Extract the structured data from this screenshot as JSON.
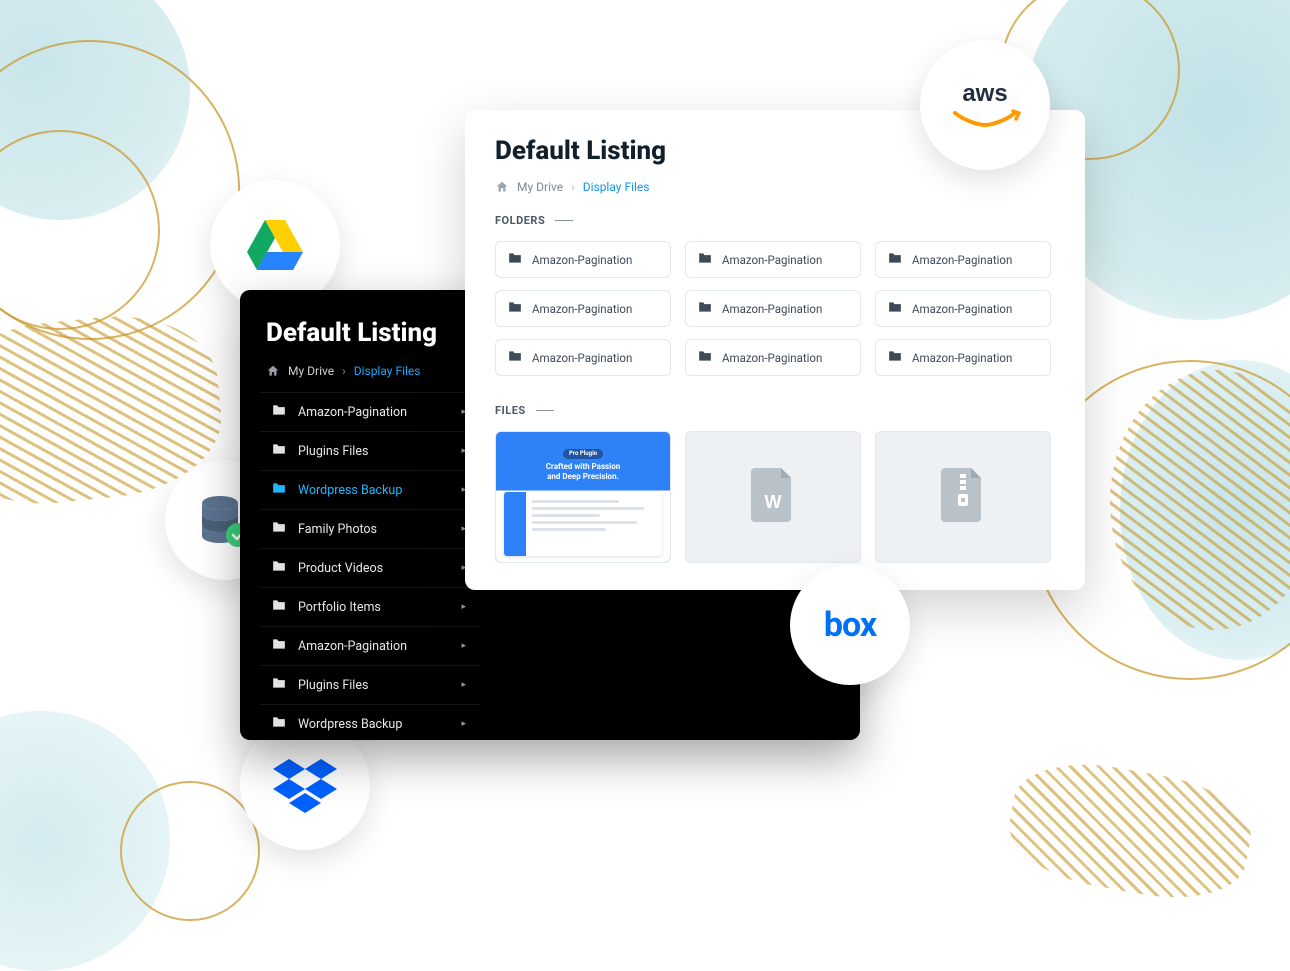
{
  "brands": {
    "gdrive": "google-drive",
    "db": "database-backup",
    "dropbox": "dropbox",
    "box": "box",
    "aws": "aws"
  },
  "dark": {
    "title": "Default Listing",
    "breadcrumbs": {
      "root": "My Drive",
      "current": "Display Files"
    },
    "items": [
      {
        "label": "Amazon-Pagination",
        "active": false
      },
      {
        "label": "Plugins Files",
        "active": false
      },
      {
        "label": "Wordpress Backup",
        "active": true
      },
      {
        "label": "Family Photos",
        "active": false
      },
      {
        "label": "Product Videos",
        "active": false
      },
      {
        "label": "Portfolio Items",
        "active": false
      },
      {
        "label": "Amazon-Pagination",
        "active": false
      },
      {
        "label": "Plugins Files",
        "active": false
      },
      {
        "label": "Wordpress Backup",
        "active": false
      }
    ]
  },
  "light": {
    "title": "Default Listing",
    "breadcrumbs": {
      "root": "My Drive",
      "current": "Display Files"
    },
    "folders_label": "FOLDERS",
    "files_label": "FILES",
    "folders": [
      "Amazon-Pagination",
      "Amazon-Pagination",
      "Amazon-Pagination",
      "Amazon-Pagination",
      "Amazon-Pagination",
      "Amazon-Pagination",
      "Amazon-Pagination",
      "Amazon-Pagination",
      "Amazon-Pagination"
    ],
    "preview": {
      "pill": "Pro Plugin",
      "line1": "Crafted with Passion",
      "line2": "and Deep Precision."
    },
    "file_types": [
      "preview",
      "word",
      "zip"
    ]
  }
}
